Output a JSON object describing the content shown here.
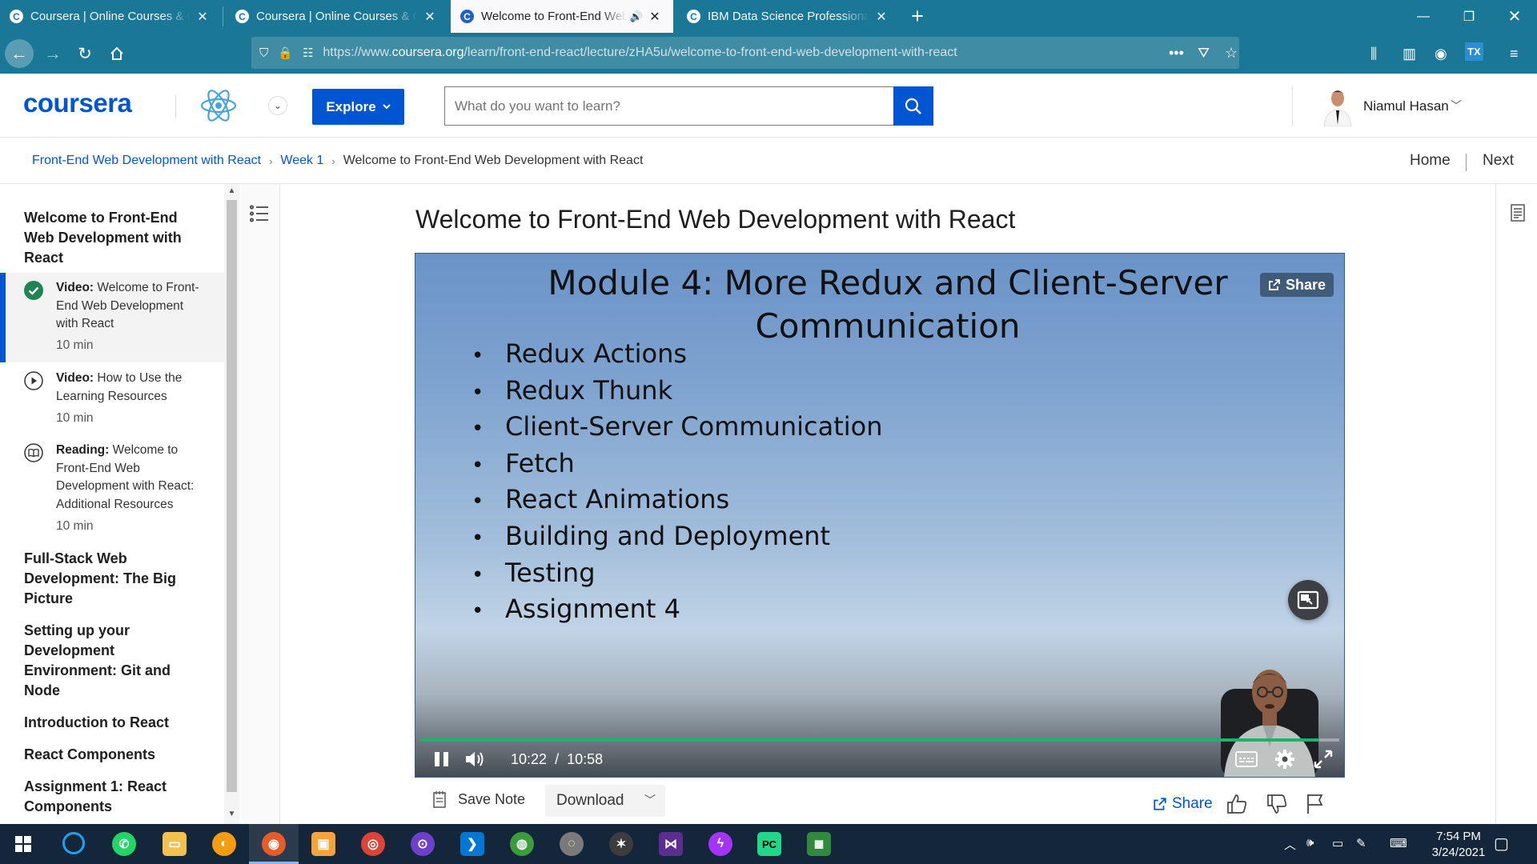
{
  "browser": {
    "tabs": [
      {
        "title": "Coursera | Online Courses & Credentials",
        "active": false
      },
      {
        "title": "Coursera | Online Courses & Credentials",
        "active": false
      },
      {
        "title": "Welcome to Front-End Web Development with React",
        "active": true,
        "audio": true
      },
      {
        "title": "IBM Data Science Professional Certificate",
        "active": false
      }
    ],
    "favicon_letter": "C",
    "url_prefix": "https://www.",
    "url_domain": "coursera.org",
    "url_path": "/learn/front-end-react/lecture/zHA5u/welcome-to-front-end-web-development-with-react",
    "colors": {
      "chrome": "#1a7896",
      "urlbar": "#3f8ca5"
    }
  },
  "header": {
    "logo": "coursera",
    "explore_label": "Explore",
    "search_placeholder": "What do you want to learn?",
    "user_name": "Niamul Hasan",
    "brand_color": "#0056d2"
  },
  "breadcrumb": {
    "course": "Front-End Web Development with React",
    "week": "Week 1",
    "current": "Welcome to Front-End Web Development with React",
    "home": "Home",
    "next": "Next"
  },
  "sidebar": {
    "current_module": "Welcome to Front-End Web Development with React",
    "items": [
      {
        "type": "Video:",
        "title": "Welcome to Front-End Web Development with React",
        "duration": "10 min",
        "status": "completed",
        "selected": true
      },
      {
        "type": "Video:",
        "title": "How to Use the Learning Resources",
        "duration": "10 min",
        "status": "video"
      },
      {
        "type": "Reading:",
        "title": "Welcome to Front-End Web Development with React: Additional Resources",
        "duration": "10 min",
        "status": "reading"
      }
    ],
    "modules": [
      "Full-Stack Web Development: The Big Picture",
      "Setting up your Development Environment: Git and Node",
      "Introduction to React",
      "React Components",
      "Assignment 1: React Components"
    ]
  },
  "main": {
    "title": "Welcome to Front-End Web Development with React",
    "video": {
      "slide_title": "Module 4: More Redux and Client-Server Communication",
      "bullets": [
        "Redux Actions",
        "Redux Thunk",
        "Client-Server Communication",
        "Fetch",
        "React Animations",
        "Building and Deployment",
        "Testing",
        "Assignment 4"
      ],
      "share_label": "Share",
      "current_time": "10:22",
      "time_separator": "/",
      "duration": "10:58",
      "progress": 0.9786,
      "progress_color": "#1fb26b"
    },
    "actions": {
      "save_note": "Save Note",
      "download": "Download",
      "share": "Share"
    }
  },
  "taskbar": {
    "time": "7:54 PM",
    "date": "3/24/2021"
  }
}
